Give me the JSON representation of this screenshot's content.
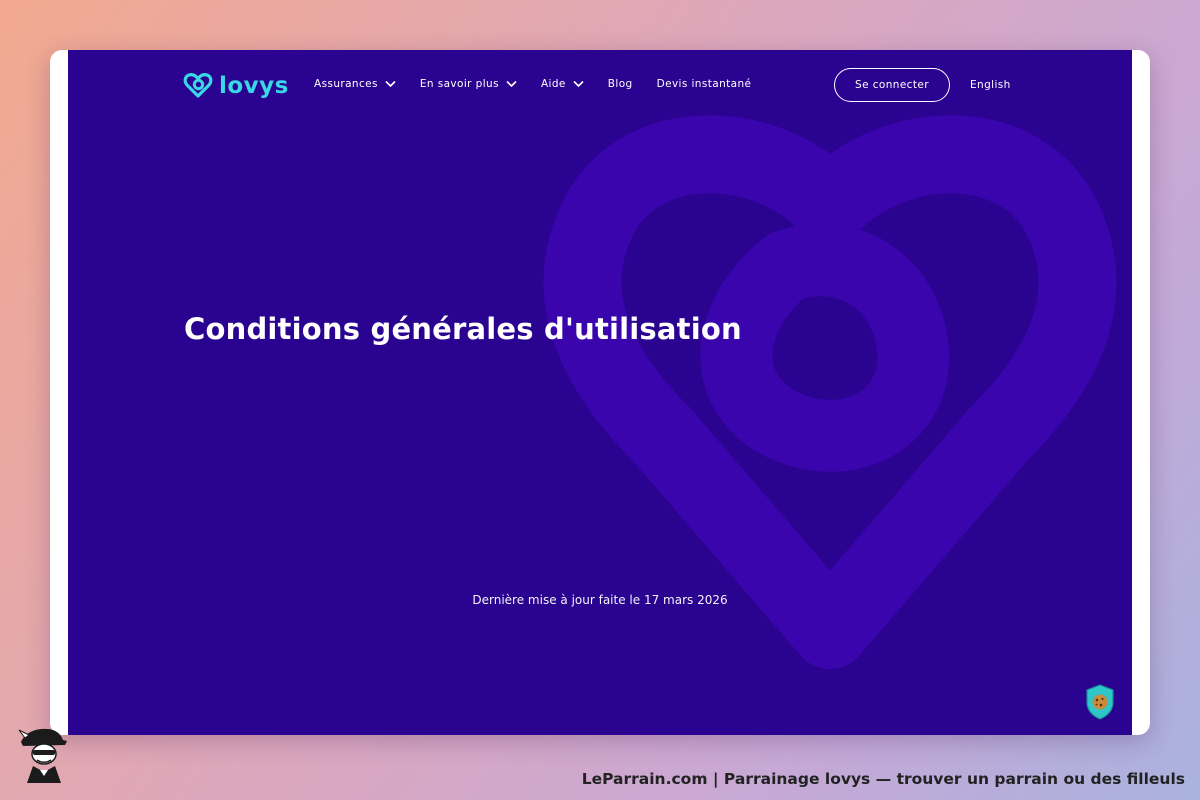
{
  "brand": {
    "name": "lovys",
    "accent": "#3ad7e6"
  },
  "nav": {
    "items": [
      {
        "label": "Assurances",
        "has_dropdown": true
      },
      {
        "label": "En savoir plus",
        "has_dropdown": true
      },
      {
        "label": "Aide",
        "has_dropdown": true
      },
      {
        "label": "Blog",
        "has_dropdown": false
      },
      {
        "label": "Devis instantané",
        "has_dropdown": false
      }
    ],
    "login_label": "Se connecter",
    "language_label": "English"
  },
  "hero": {
    "title": "Conditions générales d'utilisation",
    "updated": "Dernière mise à jour faite le 17 mars 2026"
  },
  "colors": {
    "page_background": "#2a0390",
    "heart_watermark": "#3a05ad",
    "cookie_badge": "#2ec6c8"
  },
  "icons": {
    "logo": "heart-logo-icon",
    "dropdown": "chevron-down-icon",
    "cookie": "cookie-shield-icon",
    "mascot": "detective-mascot-icon"
  },
  "footer": {
    "caption": "LeParrain.com | Parrainage lovys — trouver un parrain ou des filleuls"
  }
}
